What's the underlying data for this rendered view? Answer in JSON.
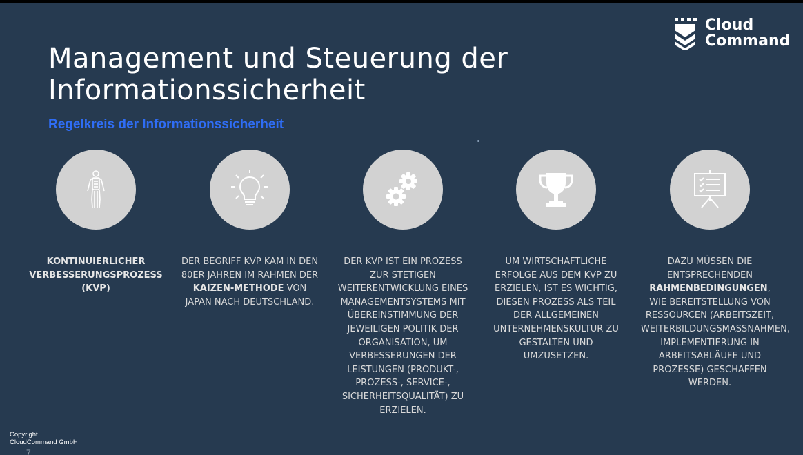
{
  "slide": {
    "title_line1": "Management und Steuerung der",
    "title_line2": "Informationssicherheit",
    "subtitle": "Regelkreis der Informationssicherheit",
    "logo": {
      "line1": "Cloud",
      "line2": "Command",
      "icon": "shield-chevron-icon"
    },
    "columns": [
      {
        "icon": "human-body-icon",
        "segments": [
          {
            "text": "Kontinuierlicher Verbesserungsprozess (KVP)",
            "bold": true
          }
        ]
      },
      {
        "icon": "lightbulb-icon",
        "segments": [
          {
            "text": "Der Begriff KVP kam in den 80er Jahren im Rahmen der ",
            "bold": false
          },
          {
            "text": "Kaizen-Methode",
            "bold": true
          },
          {
            "text": " von Japan nach Deutschland.",
            "bold": false
          }
        ]
      },
      {
        "icon": "gears-icon",
        "segments": [
          {
            "text": "Der KVP ist ein Prozess zur stetigen Weiterentwicklung eines Managementsystems mit Übereinstimmung der jeweiligen Politik der Organisation, um Verbesserungen der Leistungen (Produkt-, Prozess-, Service-, Sicherheitsqualität) zu erzielen.",
            "bold": false
          }
        ]
      },
      {
        "icon": "trophy-icon",
        "segments": [
          {
            "text": "Um wirtschaftliche Erfolge aus dem KVP zu erzielen, ist es wichtig, diesen Prozess als Teil der allgemeinen Unternehmenskultur zu gestalten und umzusetzen.",
            "bold": false
          }
        ]
      },
      {
        "icon": "presentation-board-icon",
        "segments": [
          {
            "text": "Dazu müssen die entsprechenden ",
            "bold": false
          },
          {
            "text": "Rahmenbedingungen",
            "bold": true
          },
          {
            "text": ", wie Bereitstellung von Ressourcen (Arbeitszeit, Weiterbildungsmaßnahmen, Implementierung in Arbeitsabläufe und Prozesse) geschaffen werden.",
            "bold": false
          }
        ]
      }
    ],
    "footer": {
      "copyright_line1": "Copyright",
      "copyright_line2": "CloudCommand GmbH",
      "page_number": "7"
    },
    "colors": {
      "background": "#263a50",
      "accent": "#2f6df5",
      "circle": "#d2d2d2"
    }
  }
}
